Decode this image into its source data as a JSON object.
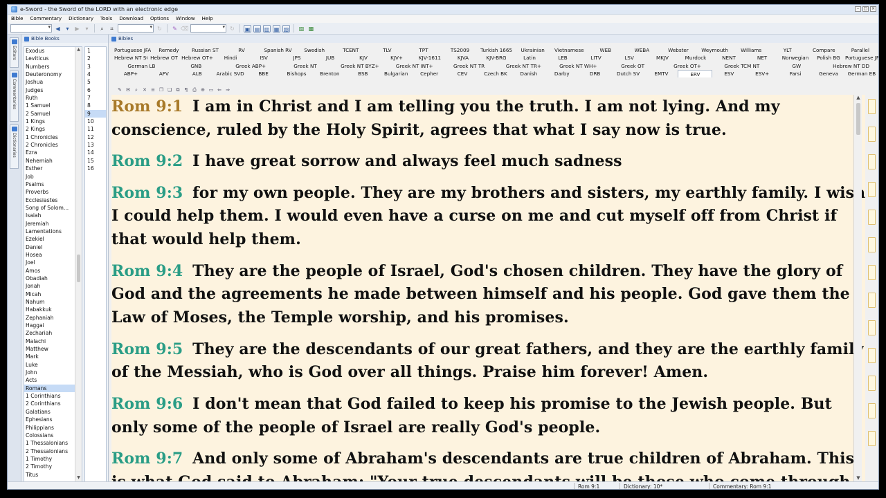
{
  "window": {
    "title": "e-Sword - the Sword of the LORD with an electronic edge"
  },
  "menu": [
    "Bible",
    "Commentary",
    "Dictionary",
    "Tools",
    "Download",
    "Options",
    "Window",
    "Help"
  ],
  "side_tabs": [
    "Editors",
    "Commentaries",
    "Dictionaries"
  ],
  "books_panel": {
    "title": "Bible Books",
    "books": [
      "Exodus",
      "Leviticus",
      "Numbers",
      "Deuteronomy",
      "Joshua",
      "Judges",
      "Ruth",
      "1 Samuel",
      "2 Samuel",
      "1 Kings",
      "2 Kings",
      "1 Chronicles",
      "2 Chronicles",
      "Ezra",
      "Nehemiah",
      "Esther",
      "Job",
      "Psalms",
      "Proverbs",
      "Ecclesiastes",
      "Song of Solom...",
      "Isaiah",
      "Jeremiah",
      "Lamentations",
      "Ezekiel",
      "Daniel",
      "Hosea",
      "Joel",
      "Amos",
      "Obadiah",
      "Jonah",
      "Micah",
      "Nahum",
      "Habakkuk",
      "Zephaniah",
      "Haggai",
      "Zechariah",
      "Malachi",
      "Matthew",
      "Mark",
      "Luke",
      "John",
      "Acts",
      "Romans",
      "1 Corinthians",
      "2 Corinthians",
      "Galatians",
      "Ephesians",
      "Philippians",
      "Colossians",
      "1 Thessalonians",
      "2 Thessalonians",
      "1 Timothy",
      "2 Timothy",
      "Titus"
    ],
    "selected_book": "Romans",
    "chapters": [
      "1",
      "2",
      "3",
      "4",
      "5",
      "6",
      "7",
      "8",
      "9",
      "10",
      "11",
      "12",
      "13",
      "14",
      "15",
      "16"
    ],
    "selected_chapter": "9"
  },
  "bibles_panel": {
    "title": "Bibles",
    "tab_rows": [
      [
        "Portuguese JFAC",
        "Remedy",
        "Russian ST",
        "RV",
        "Spanish RV",
        "Swedish",
        "TCENT",
        "TLV",
        "TPT",
        "TS2009",
        "Turkish 1665",
        "Ukrainian",
        "Vietnamese",
        "WEB",
        "WEBA",
        "Webster",
        "Weymouth",
        "Williams",
        "YLT",
        "Compare",
        "Parallel"
      ],
      [
        "Hebrew NT SG",
        "Hebrew OT",
        "Hebrew OT+",
        "Hindi",
        "ISV",
        "JPS",
        "JUB",
        "KJV",
        "KJV+",
        "KJV-1611",
        "KJVA",
        "KJV-BRG",
        "Latin",
        "LEB",
        "LITV",
        "LSV",
        "MKJV",
        "Murdock",
        "NENT",
        "NET",
        "Norwegian",
        "Polish BG",
        "Portuguese JFAA"
      ],
      [
        "German LB",
        "GNB",
        "Greek ABP+",
        "Greek NT",
        "Greek NT BYZ+",
        "Greek NT INT+",
        "Greek NT TR",
        "Greek NT TR+",
        "Greek NT WH+",
        "Greek OT",
        "Greek OT+",
        "Greek TCM NT",
        "GW",
        "Hebrew NT DD"
      ],
      [
        "ABP+",
        "AFV",
        "ALB",
        "Arabic SVD",
        "BBE",
        "Bishops",
        "Brenton",
        "BSB",
        "Bulgarian",
        "Cepher",
        "CEV",
        "Czech BK",
        "Danish",
        "Darby",
        "DRB",
        "Dutch SV",
        "EMTV",
        "ERV",
        "ESV",
        "ESV+",
        "Farsi",
        "Geneva",
        "German EB"
      ]
    ],
    "active_version": "ERV",
    "verses": [
      {
        "ref": "Rom 9:1",
        "text": "I am in Christ and I am telling you the truth. I am not lying. And my conscience, ruled by the Holy Spirit, agrees that what I say now is true."
      },
      {
        "ref": "Rom 9:2",
        "text": "I have great sorrow and always feel much sadness"
      },
      {
        "ref": "Rom 9:3",
        "text": "for my own people. They are my brothers and sisters, my earthly family. I wish I could help them. I would even have a curse on me and cut myself off from Christ if that would help them."
      },
      {
        "ref": "Rom 9:4",
        "text": "They are the people of Israel, God's chosen children. They have the glory of God and the agreements he made between himself and his people. God gave them the Law of Moses, the Temple worship, and his promises."
      },
      {
        "ref": "Rom 9:5",
        "text": "They are the descendants of our great fathers, and they are the earthly family of the Messiah, who is God over all things. Praise him forever! Amen."
      },
      {
        "ref": "Rom 9:6",
        "text": "I don't mean that God failed to keep his promise to the Jewish people. But only some of the people of Israel are really God's people."
      },
      {
        "ref": "Rom 9:7",
        "text": "And only some of Abraham's descendants are true children of Abraham. This is what God said to Abraham: \"Your true descendants will be those who come through"
      }
    ]
  },
  "status": {
    "reference": "Rom 9:1",
    "dictionary": "Dictionary: 10*",
    "commentary": "Commentary: Rom 9:1"
  },
  "colors": {
    "reading_background": "#fdf3df",
    "verse_ref": "#2a9d86",
    "current_verse_ref": "#a87a2a"
  }
}
